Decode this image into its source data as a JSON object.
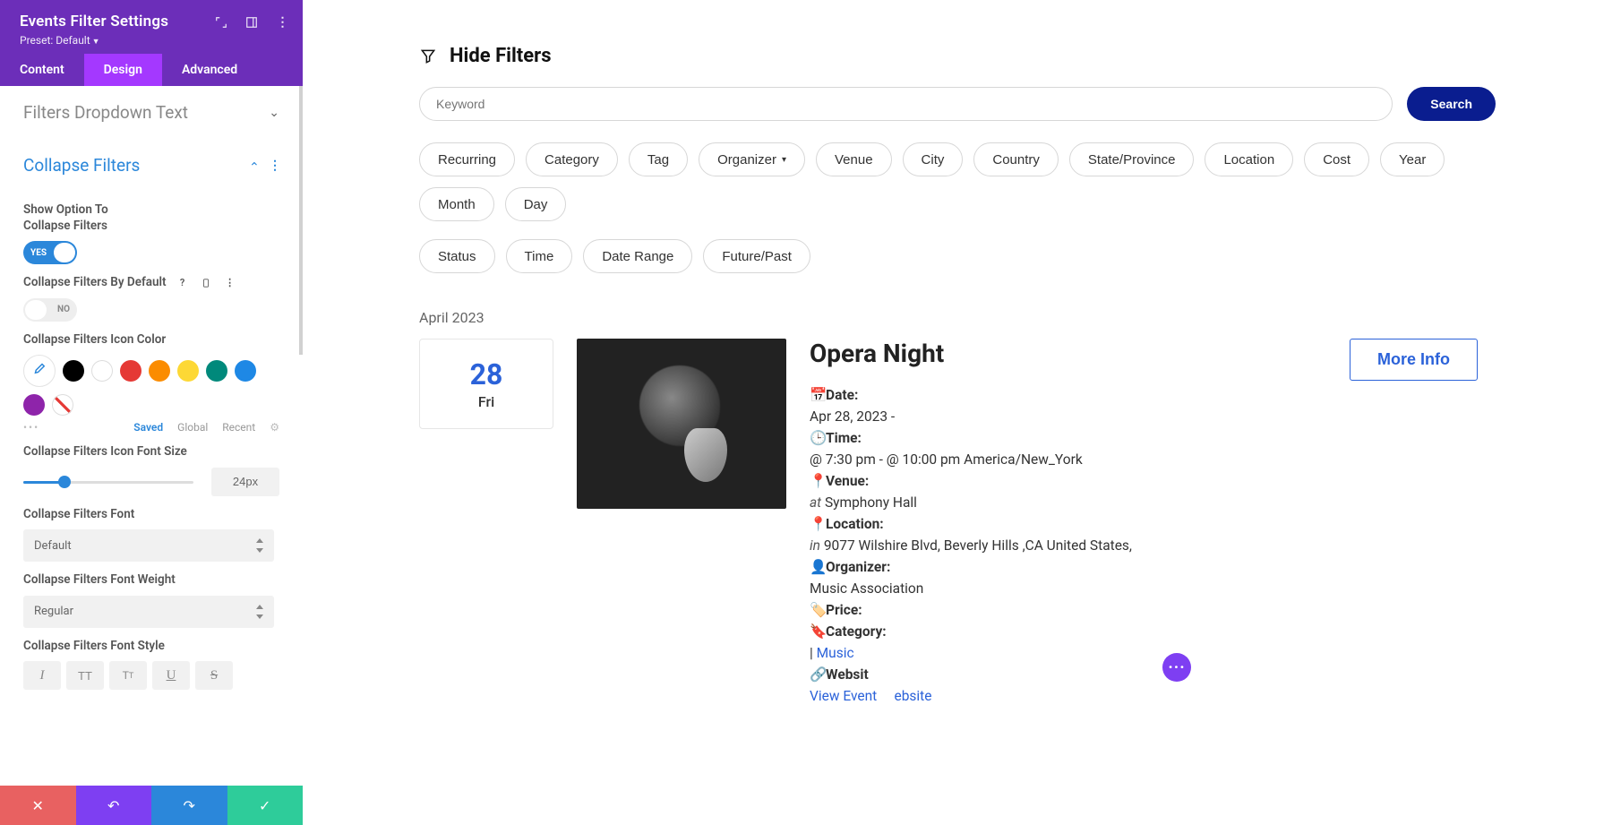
{
  "sidebar": {
    "title": "Events Filter Settings",
    "preset": "Preset: Default",
    "tabs": {
      "content": "Content",
      "design": "Design",
      "advanced": "Advanced"
    },
    "sections": {
      "dropdown_text": "Filters Dropdown Text",
      "collapse": "Collapse Filters"
    },
    "collapse": {
      "show_option_label": "Show Option To Collapse Filters",
      "show_option_value": "YES",
      "by_default_label": "Collapse Filters By Default",
      "by_default_value": "NO",
      "icon_color_label": "Collapse Filters Icon Color",
      "color_meta": {
        "saved": "Saved",
        "global": "Global",
        "recent": "Recent"
      },
      "swatches": [
        "#000000",
        "#ffffff",
        "#e53935",
        "#fb8c00",
        "#fdd835",
        "#00897b",
        "#1e88e5",
        "#8e24aa",
        "none"
      ],
      "icon_size_label": "Collapse Filters Icon Font Size",
      "icon_size_value": "24px",
      "icon_size_percent": 24,
      "font_label": "Collapse Filters Font",
      "font_value": "Default",
      "weight_label": "Collapse Filters Font Weight",
      "weight_value": "Regular",
      "style_label": "Collapse Filters Font Style"
    }
  },
  "preview": {
    "hide_filters": "Hide Filters",
    "keyword_placeholder": "Keyword",
    "search_label": "Search",
    "pills": [
      "Recurring",
      "Category",
      "Tag",
      "Organizer",
      "Venue",
      "City",
      "Country",
      "State/Province",
      "Location",
      "Cost",
      "Year",
      "Month",
      "Day"
    ],
    "pills2": [
      "Status",
      "Time",
      "Date Range",
      "Future/Past"
    ],
    "month_label": "April 2023",
    "date_card": {
      "num": "28",
      "dow": "Fri"
    },
    "event": {
      "title": "Opera Night",
      "date_label": "Date:",
      "date_value": "Apr 28, 2023 -",
      "time_label": "Time:",
      "time_value": "@ 7:30 pm - @ 10:00 pm America/New_York",
      "venue_label": "Venue:",
      "venue_prefix": "at",
      "venue_value": "Symphony Hall",
      "location_label": "Location:",
      "location_prefix": "in",
      "location_value": "9077 Wilshire Blvd, Beverly Hills ,CA United States,",
      "organizer_label": "Organizer:",
      "organizer_value": "Music Association",
      "price_label": "Price:",
      "category_label": "Category:",
      "category_sep": "| ",
      "category_link": "Music",
      "website_label": "Websit",
      "website_link": "View Event",
      "website_link2": "ebsite",
      "more_info": "More Info"
    }
  }
}
